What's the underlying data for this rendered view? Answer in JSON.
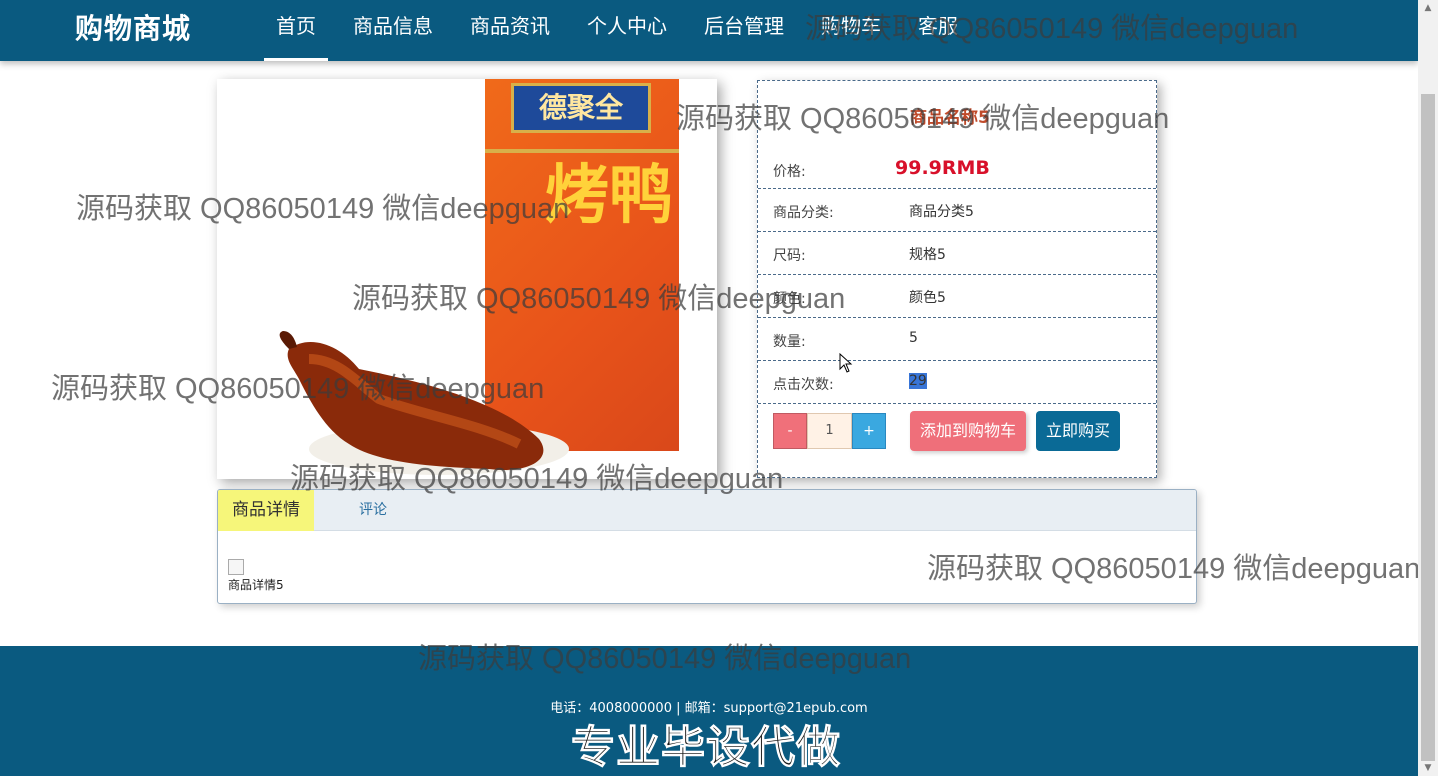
{
  "header": {
    "brand": "购物商城",
    "nav": [
      {
        "label": "首页",
        "active": true
      },
      {
        "label": "商品信息"
      },
      {
        "label": "商品资讯"
      },
      {
        "label": "个人中心"
      },
      {
        "label": "后台管理"
      },
      {
        "label": "购物车"
      },
      {
        "label": "客服"
      }
    ]
  },
  "product": {
    "title": "商品名称5",
    "price_label": "价格:",
    "price_value": "99.9RMB",
    "rows": [
      {
        "label": "商品分类:",
        "value": "商品分类5"
      },
      {
        "label": "尺码:",
        "value": "规格5"
      },
      {
        "label": "颜色:",
        "value": "颜色5"
      },
      {
        "label": "数量:",
        "value": "5"
      },
      {
        "label": "点击次数:",
        "value": "29"
      }
    ],
    "image_text": {
      "brand_label": "德聚全",
      "main": "烤鸭"
    },
    "quantity": {
      "minus": "-",
      "value": "1",
      "plus": "+"
    },
    "add_to_cart": "添加到购物车",
    "buy_now": "立即购买"
  },
  "tabs": {
    "items": [
      "商品详情",
      "评论"
    ],
    "detail_text": "商品详情5"
  },
  "footer": {
    "contact": "电话：4008000000 | 邮箱：support@21epub.com"
  },
  "overlay": {
    "watermark": "源码获取 QQ86050149 微信deepguan",
    "promo": "专业毕设代做"
  },
  "colors": {
    "nav_bg": "#0a5a80",
    "price": "#d8102a",
    "cart_button": "#ef6f7a",
    "buy_button": "#0a6a96",
    "active_tab": "#f6f67a"
  }
}
